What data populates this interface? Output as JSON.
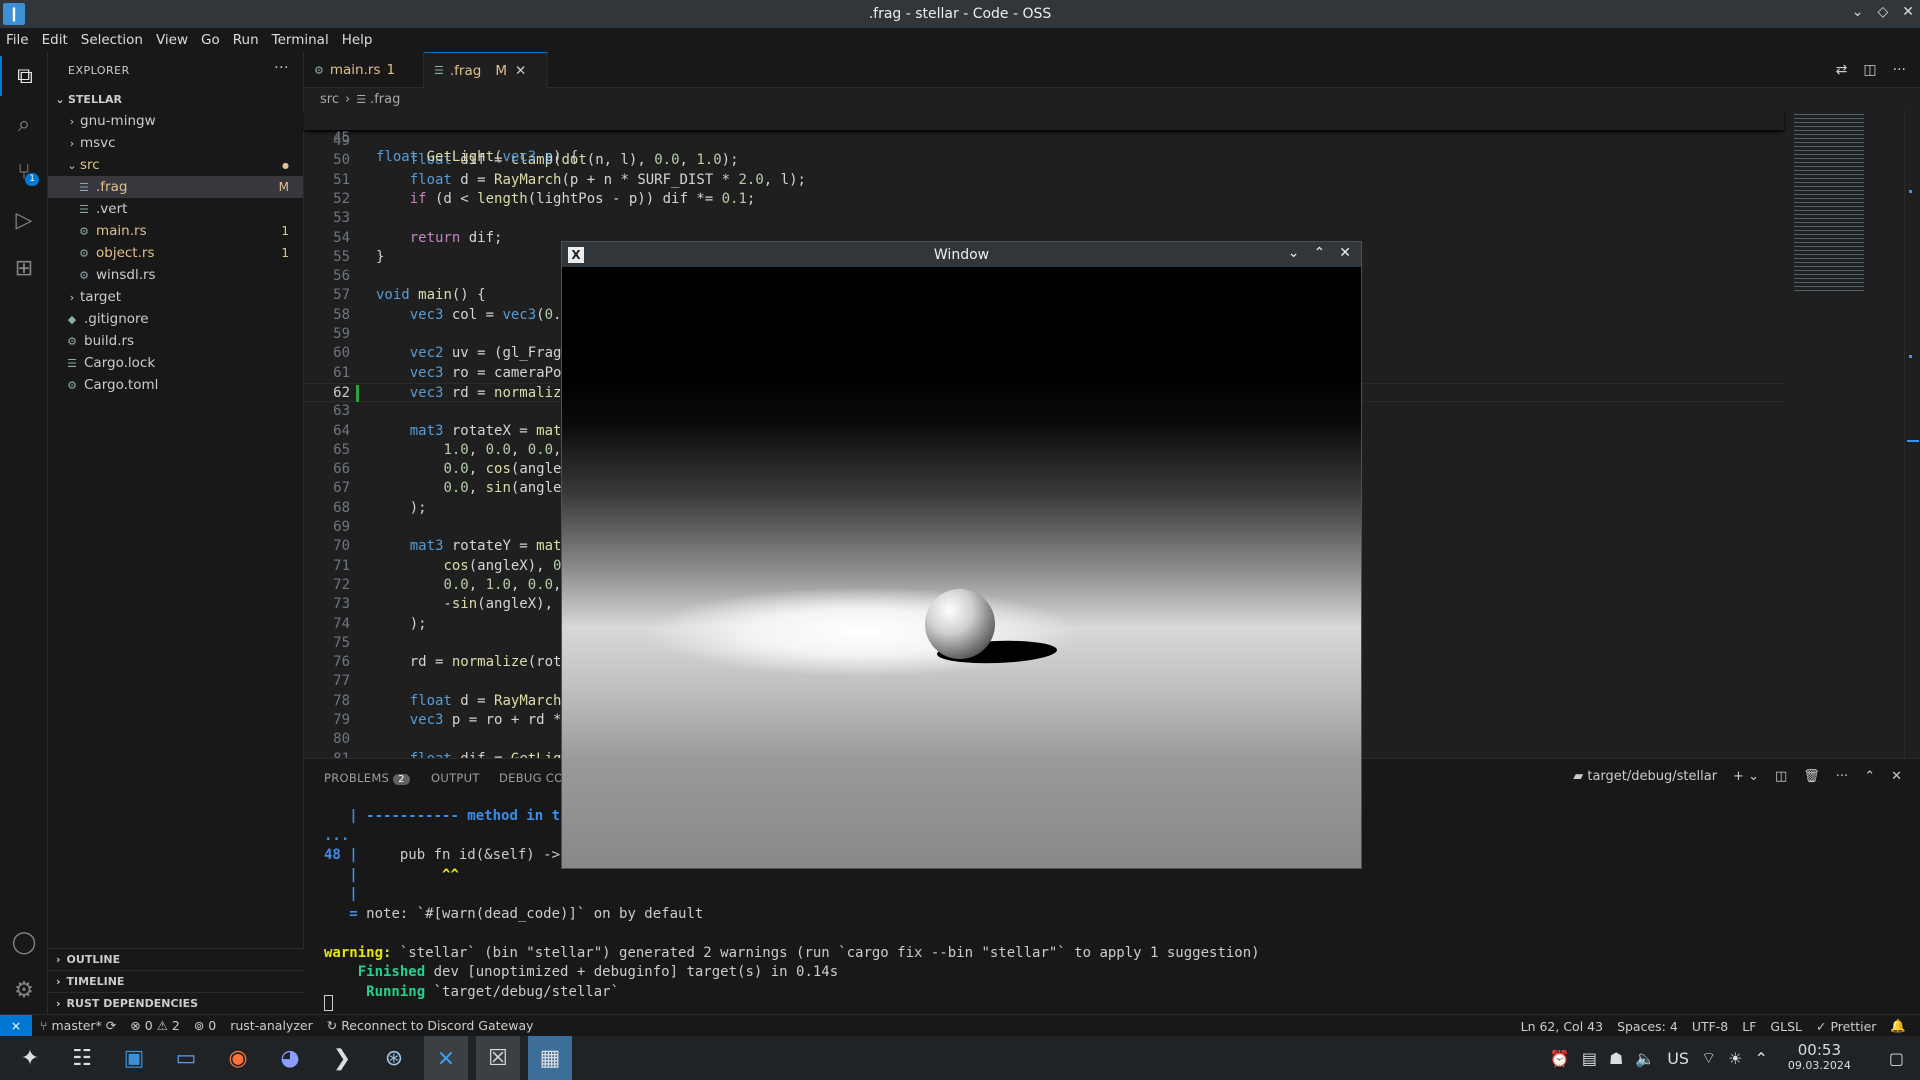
{
  "titlebar": {
    "title": ".frag - stellar - Code - OSS"
  },
  "menu": [
    "File",
    "Edit",
    "Selection",
    "View",
    "Go",
    "Run",
    "Terminal",
    "Help"
  ],
  "activity": {
    "scm_badge": "1"
  },
  "explorer": {
    "header": "EXPLORER",
    "root": "STELLAR",
    "items": [
      {
        "label": "gnu-mingw",
        "type": "folder",
        "indent": 1,
        "state": "closed"
      },
      {
        "label": "msvc",
        "type": "folder",
        "indent": 1,
        "state": "closed"
      },
      {
        "label": "src",
        "type": "folder",
        "indent": 1,
        "state": "open",
        "deco": "●"
      },
      {
        "label": ".frag",
        "type": "file",
        "indent": 2,
        "deco": "M",
        "selected": true
      },
      {
        "label": ".vert",
        "type": "file",
        "indent": 2
      },
      {
        "label": "main.rs",
        "type": "rust",
        "indent": 2,
        "deco": "1"
      },
      {
        "label": "object.rs",
        "type": "rust",
        "indent": 2,
        "deco": "1"
      },
      {
        "label": "winsdl.rs",
        "type": "rust",
        "indent": 2
      },
      {
        "label": "target",
        "type": "folder",
        "indent": 1,
        "state": "closed"
      },
      {
        "label": ".gitignore",
        "type": "git",
        "indent": 1
      },
      {
        "label": "build.rs",
        "type": "rust",
        "indent": 1
      },
      {
        "label": "Cargo.lock",
        "type": "file",
        "indent": 1
      },
      {
        "label": "Cargo.toml",
        "type": "gear",
        "indent": 1
      }
    ],
    "sections": [
      "OUTLINE",
      "TIMELINE",
      "RUST DEPENDENCIES"
    ]
  },
  "tabs": [
    {
      "label": "main.rs",
      "suffix": "1"
    },
    {
      "label": ".frag",
      "suffix": "M"
    }
  ],
  "breadcrumb": {
    "folder": "src",
    "file": ".frag"
  },
  "editor": {
    "sticky": {
      "num": "45",
      "text": "float GetLight(vec3 p) {"
    },
    "current_line": "62",
    "lines": [
      {
        "n": "49",
        "t": ""
      },
      {
        "n": "50",
        "t": "    float dif = clamp(dot(n, l), 0.0, 1.0);"
      },
      {
        "n": "51",
        "t": "    float d = RayMarch(p + n * SURF_DIST * 2.0, l);"
      },
      {
        "n": "52",
        "t": "    if (d < length(lightPos - p)) dif *= 0.1;"
      },
      {
        "n": "53",
        "t": ""
      },
      {
        "n": "54",
        "t": "    return dif;"
      },
      {
        "n": "55",
        "t": "}"
      },
      {
        "n": "56",
        "t": ""
      },
      {
        "n": "57",
        "t": "void main() {"
      },
      {
        "n": "58",
        "t": "    vec3 col = vec3(0."
      },
      {
        "n": "59",
        "t": ""
      },
      {
        "n": "60",
        "t": "    vec2 uv = (gl_Frag"
      },
      {
        "n": "61",
        "t": "    vec3 ro = cameraPo"
      },
      {
        "n": "62",
        "t": "    vec3 rd = normaliz"
      },
      {
        "n": "63",
        "t": ""
      },
      {
        "n": "64",
        "t": "    mat3 rotateX = mat"
      },
      {
        "n": "65",
        "t": "        1.0, 0.0, 0.0,"
      },
      {
        "n": "66",
        "t": "        0.0, cos(angle"
      },
      {
        "n": "67",
        "t": "        0.0, sin(angle"
      },
      {
        "n": "68",
        "t": "    );"
      },
      {
        "n": "69",
        "t": ""
      },
      {
        "n": "70",
        "t": "    mat3 rotateY = mat"
      },
      {
        "n": "71",
        "t": "        cos(angleX), 0"
      },
      {
        "n": "72",
        "t": "        0.0, 1.0, 0.0,"
      },
      {
        "n": "73",
        "t": "        -sin(angleX), "
      },
      {
        "n": "74",
        "t": "    );"
      },
      {
        "n": "75",
        "t": ""
      },
      {
        "n": "76",
        "t": "    rd = normalize(rot"
      },
      {
        "n": "77",
        "t": ""
      },
      {
        "n": "78",
        "t": "    float d = RayMarch"
      },
      {
        "n": "79",
        "t": "    vec3 p = ro + rd *"
      },
      {
        "n": "80",
        "t": ""
      },
      {
        "n": "81",
        "t": "    float dif = GetLig"
      }
    ]
  },
  "panel": {
    "tabs": [
      "PROBLEMS",
      "OUTPUT",
      "DEBUG CON"
    ],
    "problems_count": "2",
    "terminal_name": "target/debug/stellar",
    "lines": [
      {
        "a": "   | ",
        "b": "----------- method in thi",
        "cls": "tb"
      },
      {
        "a": "...",
        "b": "",
        "cls": "tb"
      },
      {
        "a": "48 |",
        "b": "     pub fn id(&self) -> ",
        "cls": "mix"
      },
      {
        "a": "   | ",
        "b": "         ^^",
        "cls": "ty2"
      },
      {
        "a": "   |",
        "b": "",
        "cls": "tb"
      },
      {
        "a": "   = ",
        "b": "note: `#[warn(dead_code)]` on by default",
        "cls": "note"
      },
      {
        "a": "",
        "b": "",
        "cls": ""
      },
      {
        "a": "warning:",
        "b": " `stellar` (bin \"stellar\") generated 2 warnings (run `cargo fix --bin \"stellar\"` to apply 1 suggestion)",
        "cls": "warn"
      },
      {
        "a": "    Finished",
        "b": " dev [unoptimized + debuginfo] target(s) in 0.14s",
        "cls": "green"
      },
      {
        "a": "     Running",
        "b": " `target/debug/stellar`",
        "cls": "green"
      }
    ]
  },
  "status": {
    "branch": "master*",
    "errors": "0",
    "warnings": "2",
    "ports": "0",
    "analyzer": "rust-analyzer",
    "discord": "Reconnect to Discord Gateway",
    "position": "Ln 62, Col 43",
    "spaces": "Spaces: 4",
    "encoding": "UTF-8",
    "eol": "LF",
    "lang": "GLSL",
    "prettier": "Prettier"
  },
  "x11": {
    "title": "Window"
  },
  "taskbar": {
    "layout": "US",
    "time": "00:53",
    "date": "09.03.2024"
  }
}
